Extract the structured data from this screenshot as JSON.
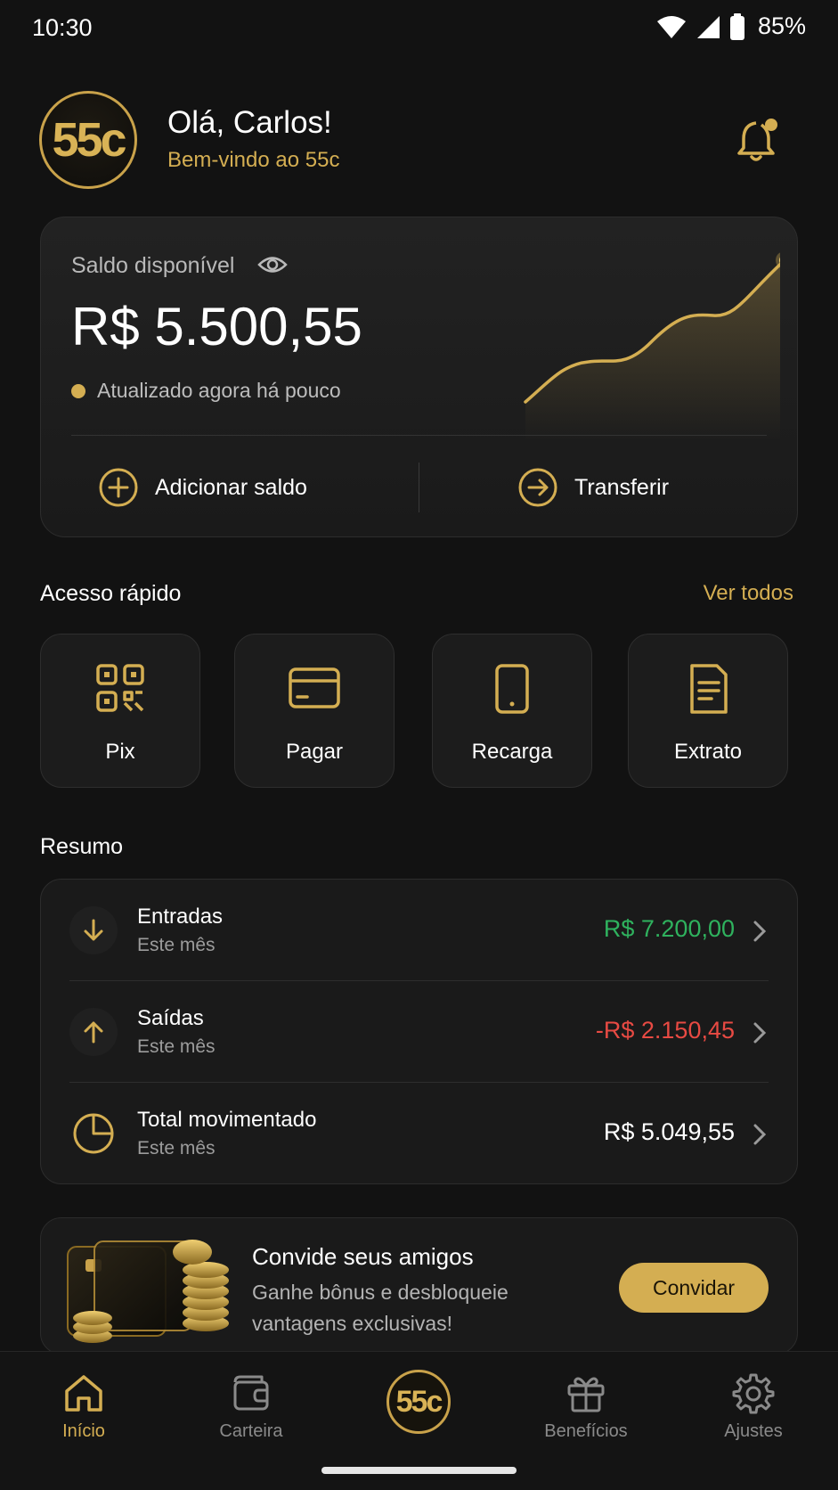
{
  "status_bar": {
    "time": "10:30",
    "battery": "85%"
  },
  "header": {
    "logo": "55c",
    "greeting": "Olá, Carlos!",
    "welcome": "Bem-vindo ao 55c"
  },
  "balance": {
    "label": "Saldo disponível",
    "value": "R$ 5.500,55",
    "updated": "Atualizado agora há pouco",
    "add_label": "Adicionar saldo",
    "transfer_label": "Transferir"
  },
  "quick_access": {
    "title": "Acesso rápido",
    "see_all": "Ver todos",
    "items": [
      {
        "label": "Pix",
        "icon": "qr-code-icon"
      },
      {
        "label": "Pagar",
        "icon": "card-icon"
      },
      {
        "label": "Recarga",
        "icon": "phone-icon"
      },
      {
        "label": "Extrato",
        "icon": "document-icon"
      }
    ]
  },
  "summary": {
    "title": "Resumo",
    "rows": [
      {
        "title": "Entradas",
        "subtitle": "Este mês",
        "amount": "R$ 7.200,00",
        "icon": "arrow-down-icon"
      },
      {
        "title": "Saídas",
        "subtitle": "Este mês",
        "amount": "-R$ 2.150,45",
        "icon": "arrow-up-icon"
      },
      {
        "title": "Total movimentado",
        "subtitle": "Este mês",
        "amount": "R$ 5.049,55",
        "icon": "pie-chart-icon"
      }
    ]
  },
  "invite": {
    "title": "Convide seus amigos",
    "text": "Ganhe bônus e desbloqueie vantagens exclusivas!",
    "button": "Convidar"
  },
  "nav": {
    "items": [
      {
        "label": "Início",
        "icon": "home-icon",
        "active": true
      },
      {
        "label": "Carteira",
        "icon": "wallet-icon"
      },
      {
        "label": "55c",
        "icon": "logo"
      },
      {
        "label": "Benefícios",
        "icon": "gift-icon"
      },
      {
        "label": "Ajustes",
        "icon": "gear-icon"
      }
    ]
  },
  "colors": {
    "accent": "#d4ae52",
    "background": "#121212",
    "positive": "#2fb25e",
    "negative": "#e84a43"
  }
}
